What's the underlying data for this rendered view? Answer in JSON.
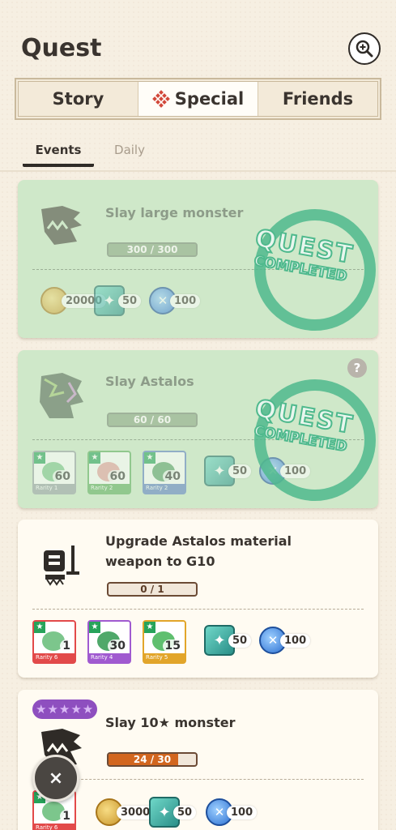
{
  "header": {
    "title": "Quest",
    "search_icon": "magnify-plus-icon"
  },
  "tabs": [
    {
      "label": "Story",
      "active": false
    },
    {
      "label": "Special",
      "active": true,
      "icon": "special-diamond-icon"
    },
    {
      "label": "Friends",
      "active": false
    }
  ],
  "subtabs": [
    {
      "label": "Events",
      "active": true
    },
    {
      "label": "Daily",
      "active": false
    }
  ],
  "quests": [
    {
      "title": "Slay large monster",
      "progress_text": "300 / 300",
      "progress": 1.0,
      "completed": true,
      "stamp_line1": "QUEST",
      "stamp_line2": "COMPLETED",
      "rewards": [
        {
          "type": "zenny",
          "qty": "20000"
        },
        {
          "type": "gem",
          "qty": "50"
        },
        {
          "type": "orb",
          "qty": "100"
        }
      ]
    },
    {
      "title": "Slay Astalos",
      "progress_text": "60 / 60",
      "progress": 1.0,
      "completed": true,
      "stamp_line1": "QUEST",
      "stamp_line2": "COMPLETED",
      "help": "?",
      "materials": [
        {
          "qty": "60",
          "rarity": "Rarity 1",
          "color": "#9aa0a6"
        },
        {
          "qty": "60",
          "rarity": "Rarity 2",
          "color": "#5fae5f"
        },
        {
          "qty": "40",
          "rarity": "Rarity 2",
          "color": "#5f7fc4"
        }
      ],
      "rewards": [
        {
          "type": "gem",
          "qty": "50"
        },
        {
          "type": "orb",
          "qty": "100"
        }
      ]
    },
    {
      "title_line1": "Upgrade Astalos material",
      "title_line2": "weapon to G10",
      "progress_text": "0 / 1",
      "progress": 0.0,
      "completed": false,
      "materials": [
        {
          "qty": "1",
          "rarity": "Rarity 6",
          "color": "#e24a4a"
        },
        {
          "qty": "30",
          "rarity": "Rarity 4",
          "color": "#a05ad0"
        },
        {
          "qty": "15",
          "rarity": "Rarity 5",
          "color": "#e2a52a"
        }
      ],
      "rewards": [
        {
          "type": "gem",
          "qty": "50"
        },
        {
          "type": "orb",
          "qty": "100"
        }
      ]
    },
    {
      "title": "Slay 10★ monster",
      "stars": "★★★★★",
      "progress_text": "24 / 30",
      "progress": 0.8,
      "completed": false,
      "materials": [
        {
          "qty": "1",
          "rarity": "Rarity 6",
          "color": "#e24a4a"
        }
      ],
      "rewards": [
        {
          "type": "zenny",
          "qty": "30000"
        },
        {
          "type": "gem",
          "qty": "50"
        },
        {
          "type": "orb",
          "qty": "100"
        }
      ]
    }
  ],
  "close_button": "×"
}
